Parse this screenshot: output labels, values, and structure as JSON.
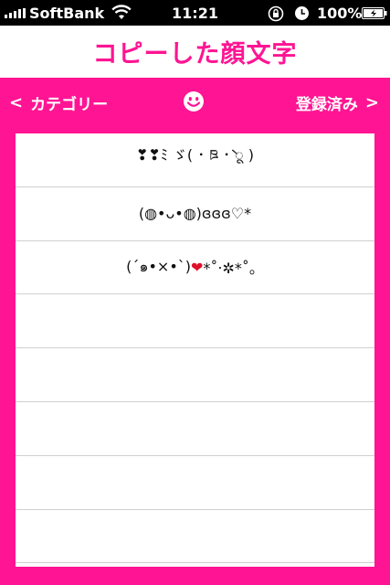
{
  "status_bar": {
    "carrier": "SoftBank",
    "time": "11:21",
    "battery": "100%"
  },
  "header": {
    "title": "コピーした顔文字"
  },
  "nav": {
    "back_label": "カテゴリー",
    "back_chevron": "<",
    "saved_label": "登録済み",
    "saved_chevron": ">"
  },
  "kaomoji": {
    "items": [
      "❣❣ﾐ ゞ( ･ ཋ ･̀ ू )",
      "(◍•ᴗ•◍)ɞɞɞ♡*",
      "(ˊ๑•×•ˋ)",
      "",
      "",
      "",
      "",
      ""
    ],
    "item3_heart": "❤",
    "item3_tail": "*˚‧✲*˚。"
  },
  "colors": {
    "accent": "#ff1493",
    "background": "#ffffff"
  }
}
